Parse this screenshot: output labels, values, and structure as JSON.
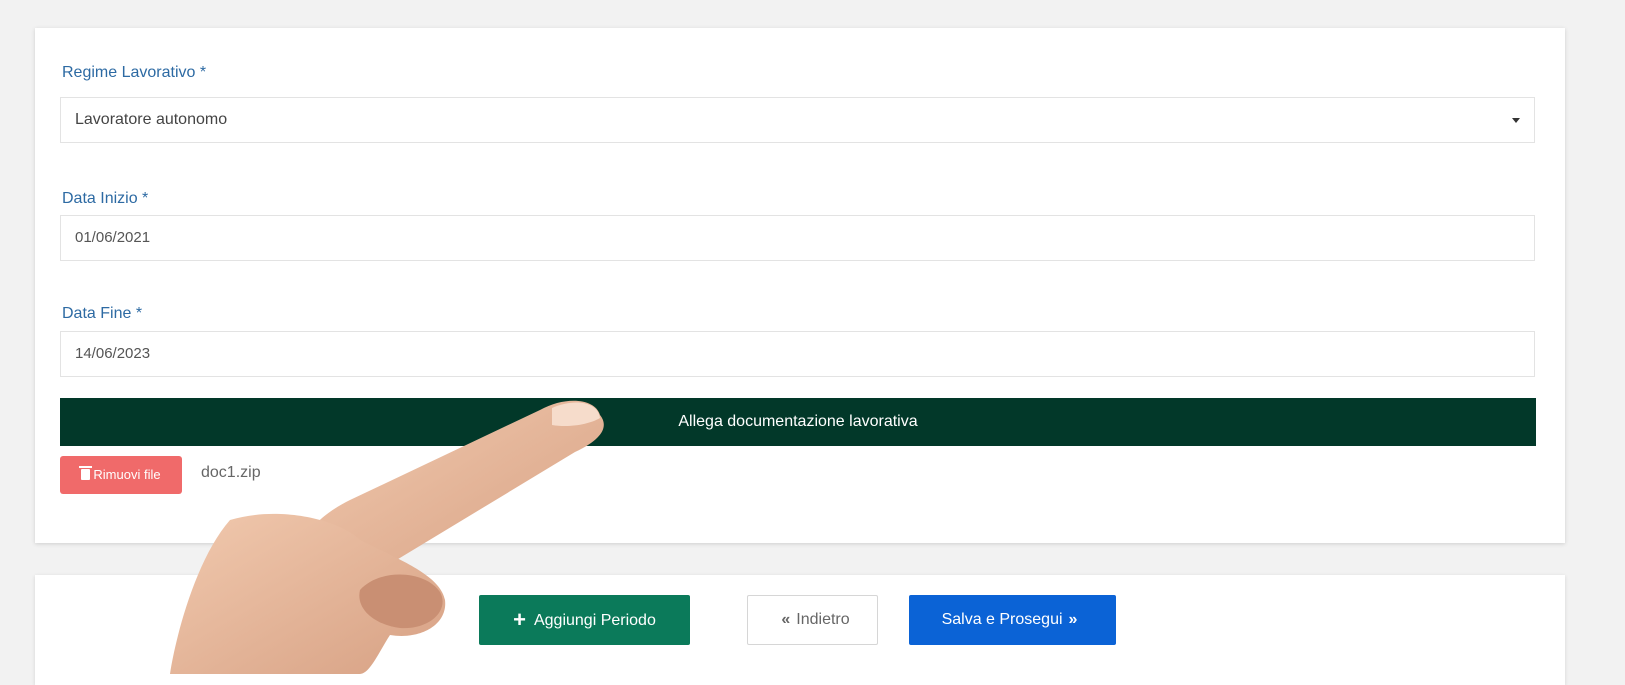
{
  "form": {
    "regime": {
      "label": "Regime Lavorativo *",
      "value": "Lavoratore autonomo"
    },
    "start_date": {
      "label": "Data Inizio *",
      "value": "01/06/2021"
    },
    "end_date": {
      "label": "Data Fine *",
      "value": "14/06/2023"
    },
    "attach_label": "Allega documentazione lavorativa",
    "remove_label": "Rimuovi file",
    "file_name": "doc1.zip"
  },
  "footer": {
    "add_period_label": "Aggiungi Periodo",
    "back_label": "Indietro",
    "save_label": "Salva e Prosegui",
    "add_icon": "plus-icon",
    "back_icon": "double-chevron-left-icon",
    "save_icon": "double-chevron-right-icon"
  },
  "colors": {
    "label": "#2d6aa3",
    "attach_bar": "#023829",
    "remove_button": "#f06a6a",
    "add_button": "#0b7a5a",
    "save_button": "#0b63d6"
  }
}
